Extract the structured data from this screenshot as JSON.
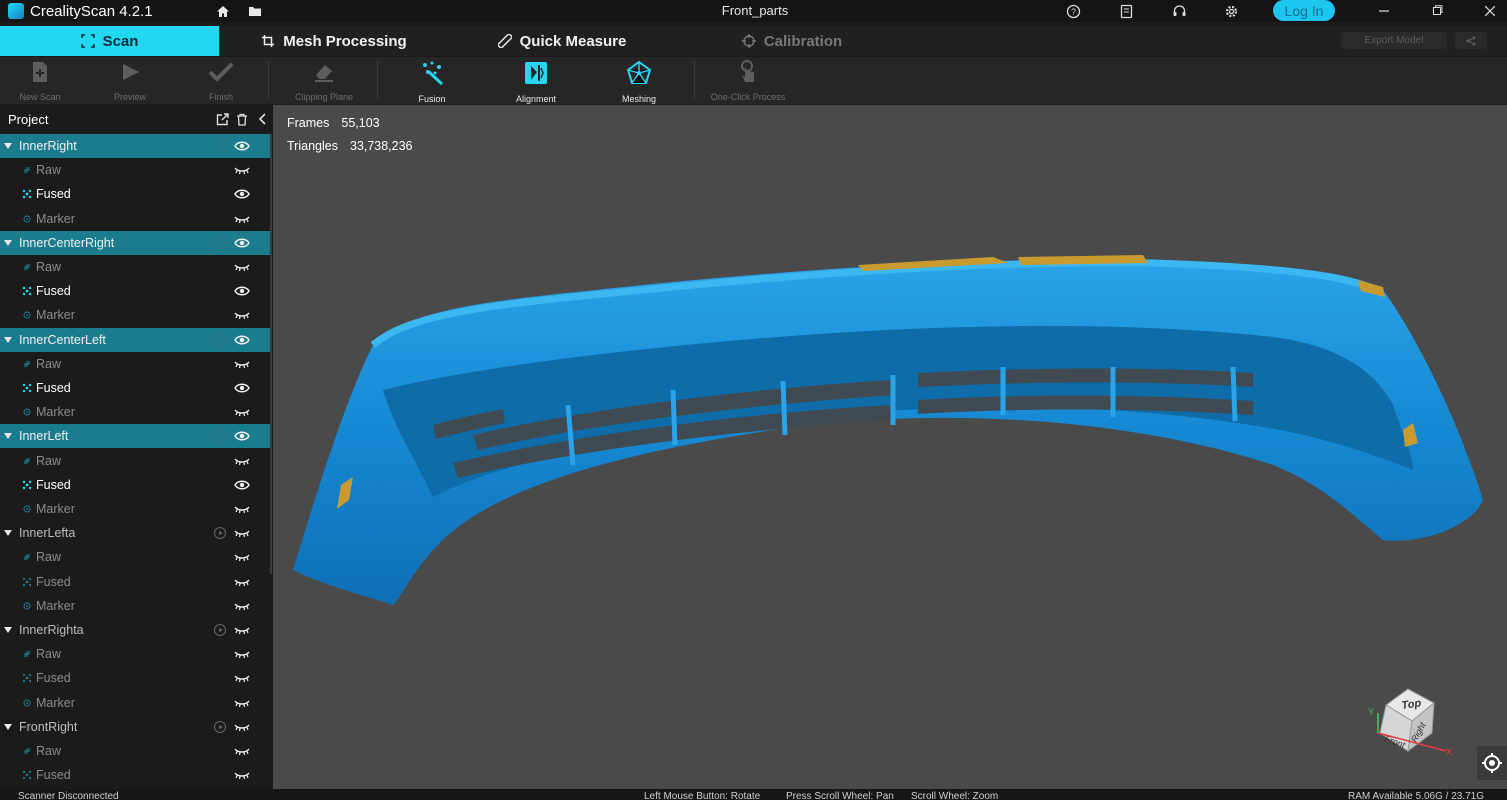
{
  "app": {
    "name": "CrealityScan 4.2.1",
    "doc_title": "Front_parts",
    "login_label": "Log In"
  },
  "tabs": [
    {
      "label": "Scan",
      "state": "active"
    },
    {
      "label": "Mesh Processing",
      "state": "normal"
    },
    {
      "label": "Quick Measure",
      "state": "normal"
    },
    {
      "label": "Calibration",
      "state": "disabled"
    }
  ],
  "tab_actions": {
    "export_label": "Export Model"
  },
  "toolbar": [
    {
      "label": "New Scan",
      "icon": "new-scan-icon",
      "enabled": false
    },
    {
      "label": "Preview",
      "icon": "play-icon",
      "enabled": false
    },
    {
      "label": "Finish",
      "icon": "check-icon",
      "enabled": false
    },
    {
      "label": "Clipping Plane",
      "icon": "eraser-icon",
      "enabled": false
    },
    {
      "label": "Fusion",
      "icon": "fusion-icon",
      "enabled": true
    },
    {
      "label": "Alignment",
      "icon": "alignment-icon",
      "enabled": true
    },
    {
      "label": "Meshing",
      "icon": "meshing-icon",
      "enabled": true
    },
    {
      "label": "One-Click Process",
      "icon": "touch-icon",
      "enabled": false
    }
  ],
  "sidebar": {
    "title": "Project",
    "groups": [
      {
        "name": "InnerRight",
        "selected": true,
        "visible": true,
        "children": [
          {
            "label": "Raw",
            "visible": false,
            "active": false
          },
          {
            "label": "Fused",
            "visible": true,
            "active": true
          },
          {
            "label": "Marker",
            "visible": false,
            "active": false
          }
        ]
      },
      {
        "name": "InnerCenterRight",
        "selected": true,
        "visible": true,
        "children": [
          {
            "label": "Raw",
            "visible": false,
            "active": false
          },
          {
            "label": "Fused",
            "visible": true,
            "active": true
          },
          {
            "label": "Marker",
            "visible": false,
            "active": false
          }
        ]
      },
      {
        "name": "InnerCenterLeft",
        "selected": true,
        "visible": true,
        "children": [
          {
            "label": "Raw",
            "visible": false,
            "active": false
          },
          {
            "label": "Fused",
            "visible": true,
            "active": true
          },
          {
            "label": "Marker",
            "visible": false,
            "active": false
          }
        ]
      },
      {
        "name": "InnerLeft",
        "selected": true,
        "visible": true,
        "children": [
          {
            "label": "Raw",
            "visible": false,
            "active": false
          },
          {
            "label": "Fused",
            "visible": true,
            "active": true
          },
          {
            "label": "Marker",
            "visible": false,
            "active": false
          }
        ]
      },
      {
        "name": "InnerLefta",
        "selected": false,
        "visible": false,
        "children": [
          {
            "label": "Raw",
            "visible": false,
            "active": false
          },
          {
            "label": "Fused",
            "visible": false,
            "active": false
          },
          {
            "label": "Marker",
            "visible": false,
            "active": false
          }
        ]
      },
      {
        "name": "InnerRighta",
        "selected": false,
        "visible": false,
        "children": [
          {
            "label": "Raw",
            "visible": false,
            "active": false
          },
          {
            "label": "Fused",
            "visible": false,
            "active": false
          },
          {
            "label": "Marker",
            "visible": false,
            "active": false
          }
        ]
      },
      {
        "name": "FrontRight",
        "selected": false,
        "visible": false,
        "children": [
          {
            "label": "Raw",
            "visible": false,
            "active": false
          },
          {
            "label": "Fused",
            "visible": false,
            "active": false
          }
        ]
      }
    ]
  },
  "viewport": {
    "frames_label": "Frames",
    "frames_value": "55,103",
    "triangles_label": "Triangles",
    "triangles_value": "33,738,236",
    "view_cube": {
      "top": "Top",
      "front": "Front",
      "right": "Right",
      "axis_x": "X",
      "axis_y": "Y"
    }
  },
  "status": {
    "scanner": "Scanner Disconnected",
    "hint_rotate": "Left Mouse Button: Rotate",
    "hint_pan": "Press Scroll Wheel: Pan",
    "hint_zoom": "Scroll Wheel: Zoom",
    "ram": "RAM Available 5.06G / 23.71G"
  },
  "colors": {
    "accent": "#22d8f0",
    "selected_row": "#1b7c8e",
    "mesh": "#1a8fd8",
    "viewport_bg": "#4a4a4a"
  }
}
